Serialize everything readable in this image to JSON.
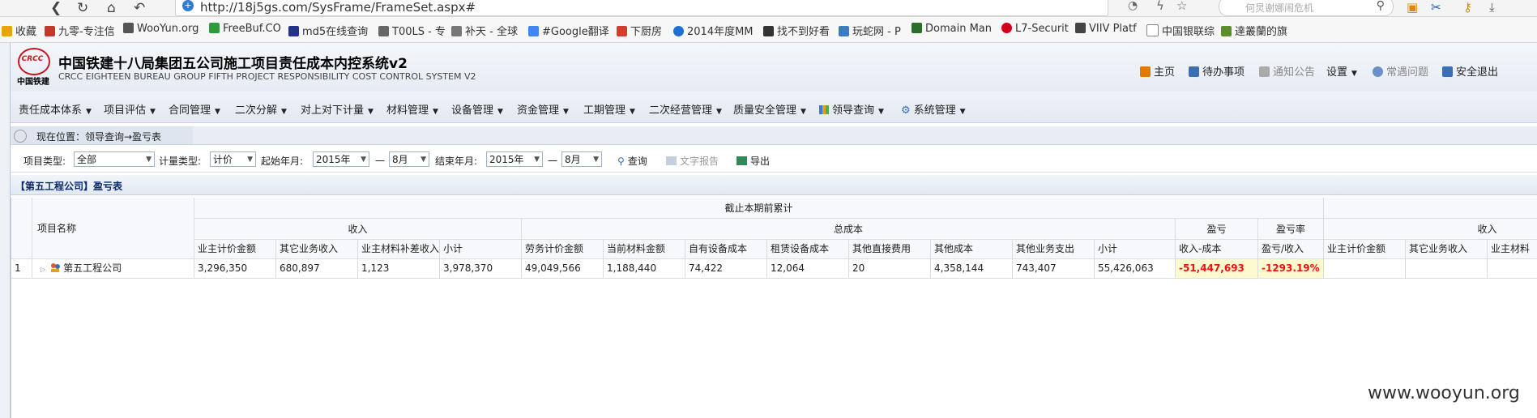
{
  "browser": {
    "url": "http://18j5gs.com/SysFrame/FrameSet.aspx#",
    "search_placeholder": "何炅谢娜闹危机"
  },
  "bookmarks": [
    {
      "label": "收藏",
      "color": "#e8a400"
    },
    {
      "label": "九零-专注信",
      "color": "#c0392b"
    },
    {
      "label": "WooYun.org",
      "color": "#555555"
    },
    {
      "label": "FreeBuf.CO",
      "color": "#2e9b3a"
    },
    {
      "label": "md5在线查询",
      "color": "#223388"
    },
    {
      "label": "T00LS - 专",
      "color": "#666666"
    },
    {
      "label": "补天 - 全球",
      "color": "#777777"
    },
    {
      "label": "#Google翻译",
      "color": "#4285f4"
    },
    {
      "label": "下厨房",
      "color": "#d33d2e"
    },
    {
      "label": "2014年度MM",
      "color": "#1d6fd1"
    },
    {
      "label": "找不到好看",
      "color": "#333333"
    },
    {
      "label": "玩蛇网 - P",
      "color": "#3b7bbf"
    },
    {
      "label": "Domain Man",
      "color": "#2a6e2a"
    },
    {
      "label": "L7-Securit",
      "color": "#d0021b"
    },
    {
      "label": "VIIV Platf",
      "color": "#444444"
    },
    {
      "label": "中国银联综",
      "color": "#888888"
    },
    {
      "label": "達叢蘭的旗",
      "color": "#5a8f29"
    }
  ],
  "app": {
    "logo_text": "CRCC",
    "logo_cn": "中国铁建",
    "title": "中国铁建十八局集团五公司施工项目责任成本内控系统v2",
    "subtitle": "CRCC EIGHTEEN BUREAU GROUP FIFTH PROJECT RESPONSIBILITY COST CONTROL SYSTEM V2",
    "header_links": [
      {
        "label": "主页",
        "color": "#e07b00"
      },
      {
        "label": "待办事项",
        "color": "#3a6fb5"
      },
      {
        "label": "通知公告",
        "color": "#999999"
      },
      {
        "label": "设置",
        "color": ""
      },
      {
        "label": "常遇问题",
        "color": "#6b8fc9"
      },
      {
        "label": "安全退出",
        "color": "#3a6fb5"
      }
    ]
  },
  "menu": [
    "责任成本体系",
    "项目评估",
    "合同管理",
    "二次分解",
    "对上对下计量",
    "材料管理",
    "设备管理",
    "资金管理",
    "工期管理",
    "二次经营管理",
    "质量安全管理",
    "领导查询",
    "系统管理"
  ],
  "breadcrumb": "现在位置：领导查询→盈亏表",
  "filters": {
    "project_type_label": "项目类型:",
    "project_type_value": "全部",
    "measure_type_label": "计量类型:",
    "measure_type_value": "计价",
    "start_label": "起始年月:",
    "start_year": "2015年",
    "start_month": "8月",
    "end_label": "结束年月:",
    "end_year": "2015年",
    "end_month": "8月",
    "dash": "一",
    "query_btn": "查询",
    "report_btn": "文字报告",
    "export_btn": "导出"
  },
  "report_title": "【第五工程公司】盈亏表",
  "grid": {
    "col_project": "项目名称",
    "group_top": "截止本期前累计",
    "group_income": "收入",
    "group_cost": "总成本",
    "group_profit": "盈亏",
    "group_rate": "盈亏率",
    "group_income2": "收入",
    "income_cols": [
      "业主计价金额",
      "其它业务收入",
      "业主材料补差收入",
      "小计"
    ],
    "cost_cols": [
      "劳务计价金额",
      "当前材料金额",
      "自有设备成本",
      "租赁设备成本",
      "其他直接费用",
      "其他成本",
      "其他业务支出",
      "小计"
    ],
    "profit_col": "收入-成本",
    "rate_col": "盈亏/收入",
    "income2_cols": [
      "业主计价金额",
      "其它业务收入",
      "业主材料"
    ],
    "rows": [
      {
        "index": "1",
        "name": "第五工程公司",
        "income": [
          "3,296,350",
          "680,897",
          "1,123",
          "3,978,370"
        ],
        "cost": [
          "49,049,566",
          "1,188,440",
          "74,422",
          "12,064",
          "20",
          "4,358,144",
          "743,407",
          "55,426,063"
        ],
        "profit": "-51,447,693",
        "rate": "-1293.19%"
      }
    ]
  },
  "watermark": "www.wooyun.org"
}
